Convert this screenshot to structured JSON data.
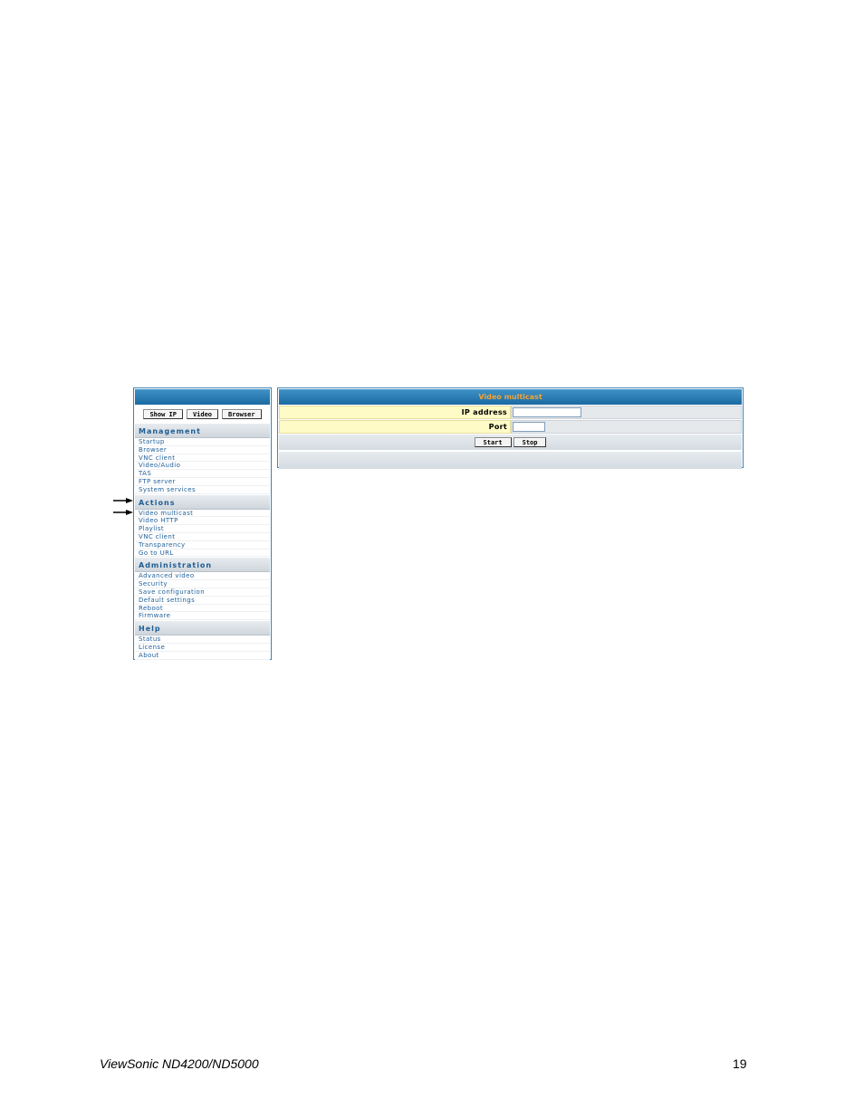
{
  "sidebar": {
    "buttons": [
      "Show IP",
      "Video",
      "Browser"
    ],
    "sections": [
      {
        "title": "Management",
        "items": [
          "Startup",
          "Browser",
          "VNC client",
          "Video/Audio",
          "TAS",
          "FTP server",
          "System services"
        ]
      },
      {
        "title": "Actions",
        "items": [
          "Video multicast",
          "Video HTTP",
          "Playlist",
          "VNC client",
          "Transparency",
          "Go to URL"
        ]
      },
      {
        "title": "Administration",
        "items": [
          "Advanced video",
          "Security",
          "Save configuration",
          "Default settings",
          "Reboot",
          "Firmware"
        ]
      },
      {
        "title": "Help",
        "items": [
          "Status",
          "License",
          "About"
        ]
      }
    ]
  },
  "panel": {
    "title": "Video multicast",
    "fields": [
      {
        "label": "IP address",
        "value": ""
      },
      {
        "label": "Port",
        "value": ""
      }
    ],
    "buttons": {
      "start": "Start",
      "stop": "Stop"
    }
  },
  "footer": {
    "product": "ViewSonic ND4200/ND5000",
    "page": "19"
  },
  "colors": {
    "header_blue": "#1b6aa3",
    "title_orange": "#f0a43a",
    "link_blue": "#1f5f99",
    "field_yellow": "#fffbc6"
  }
}
